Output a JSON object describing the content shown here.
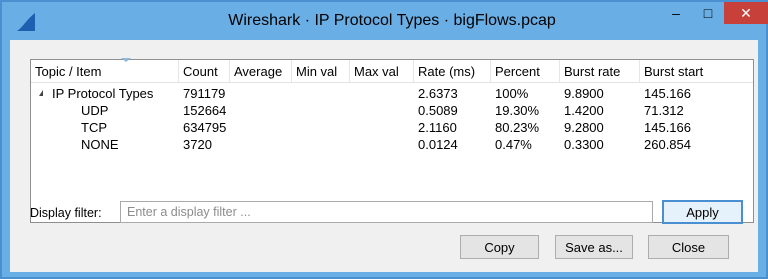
{
  "window": {
    "title": "Wireshark · IP Protocol Types · bigFlows.pcap",
    "minimize_glyph": "–",
    "maximize_glyph": "□",
    "close_glyph": "✕"
  },
  "table": {
    "columns": [
      "Topic / Item",
      "Count",
      "Average",
      "Min val",
      "Max val",
      "Rate (ms)",
      "Percent",
      "Burst rate",
      "Burst start"
    ],
    "rows": [
      {
        "item": "IP Protocol Types",
        "count": "791179",
        "average": "",
        "min": "",
        "max": "",
        "rate": "2.6373",
        "percent": "100%",
        "burst_rate": "9.8900",
        "burst_start": "145.166"
      },
      {
        "item": "UDP",
        "count": "152664",
        "average": "",
        "min": "",
        "max": "",
        "rate": "0.5089",
        "percent": "19.30%",
        "burst_rate": "1.4200",
        "burst_start": "71.312"
      },
      {
        "item": "TCP",
        "count": "634795",
        "average": "",
        "min": "",
        "max": "",
        "rate": "2.1160",
        "percent": "80.23%",
        "burst_rate": "9.2800",
        "burst_start": "145.166"
      },
      {
        "item": "NONE",
        "count": "3720",
        "average": "",
        "min": "",
        "max": "",
        "rate": "0.0124",
        "percent": "0.47%",
        "burst_rate": "0.3300",
        "burst_start": "260.854"
      }
    ]
  },
  "filter": {
    "label": "Display filter:",
    "value": "",
    "placeholder": "Enter a display filter ...",
    "apply_label": "Apply"
  },
  "buttons": {
    "copy": "Copy",
    "save_as": "Save as...",
    "close": "Close"
  },
  "colors": {
    "titlebar": "#6aaee6",
    "close_button": "#c7403a",
    "dialog_bg": "#f0f0f0"
  }
}
